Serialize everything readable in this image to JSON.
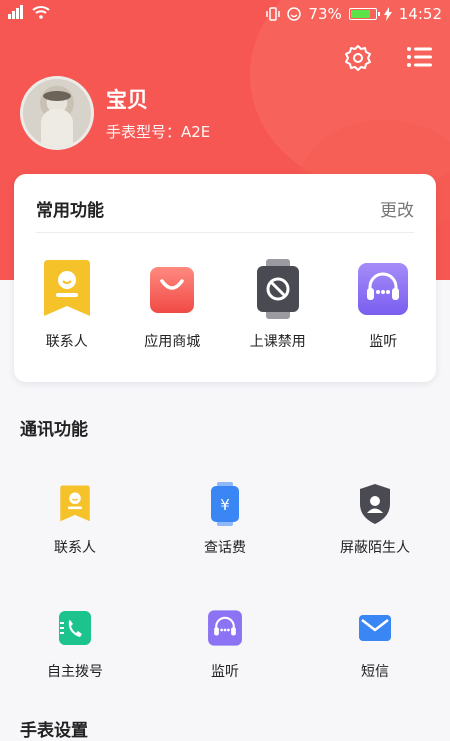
{
  "status_bar": {
    "battery": "73%",
    "time": "14:52"
  },
  "profile": {
    "name": "宝贝",
    "model": "手表型号：A2E"
  },
  "common": {
    "title": "常用功能",
    "action": "更改",
    "items": [
      {
        "label": "联系人",
        "icon": "contacts-icon"
      },
      {
        "label": "应用商城",
        "icon": "shopping-bag-icon"
      },
      {
        "label": "上课禁用",
        "icon": "watch-ban-icon"
      },
      {
        "label": "监听",
        "icon": "headset-icon"
      }
    ]
  },
  "comm": {
    "title": "通讯功能",
    "row1": [
      {
        "label": "联系人",
        "icon": "contacts-icon"
      },
      {
        "label": "查话费",
        "icon": "watch-yuan-icon"
      },
      {
        "label": "屏蔽陌生人",
        "icon": "shield-person-icon"
      }
    ],
    "row2": [
      {
        "label": "自主拨号",
        "icon": "dial-phone-icon"
      },
      {
        "label": "监听",
        "icon": "headset-icon"
      },
      {
        "label": "短信",
        "icon": "mail-icon"
      }
    ]
  },
  "watch_settings": {
    "title": "手表设置"
  },
  "colors": {
    "header": "#f65752",
    "yellow": "#f5c22a",
    "purple": "#8c73f3",
    "green": "#1dc38c",
    "blue": "#3b86f5"
  }
}
